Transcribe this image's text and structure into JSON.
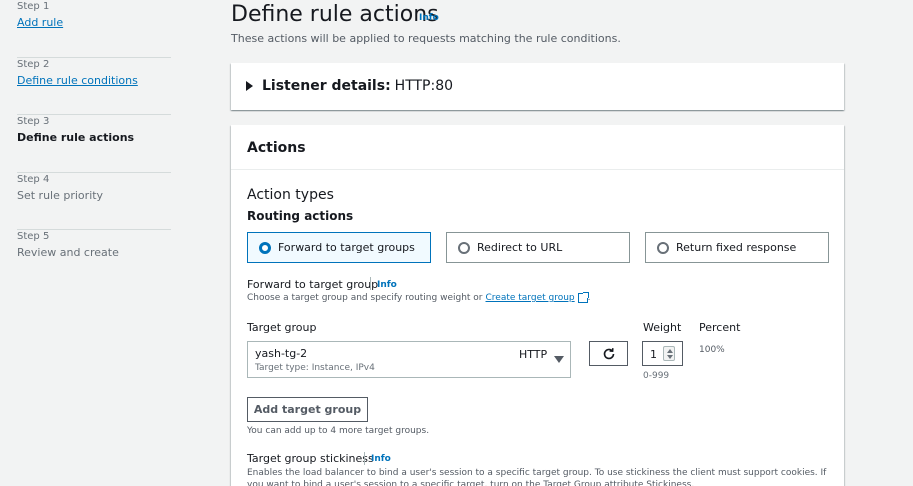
{
  "steps": [
    {
      "num": "Step 1",
      "title": "Add rule"
    },
    {
      "num": "Step 2",
      "title": "Define rule conditions"
    },
    {
      "num": "Step 3",
      "title": "Define rule actions"
    },
    {
      "num": "Step 4",
      "title": "Set rule priority"
    },
    {
      "num": "Step 5",
      "title": "Review and create"
    }
  ],
  "header": {
    "title": "Define rule actions",
    "info": "Info",
    "description": "These actions will be applied to requests matching the rule conditions."
  },
  "listener": {
    "label": "Listener details:",
    "value": "HTTP:80"
  },
  "actions": {
    "title": "Actions",
    "action_types": "Action types",
    "routing_actions": "Routing actions",
    "options": [
      {
        "label": "Forward to target groups",
        "selected": true
      },
      {
        "label": "Redirect to URL",
        "selected": false
      },
      {
        "label": "Return fixed response",
        "selected": false
      }
    ],
    "forward": {
      "label": "Forward to target group",
      "info": "Info",
      "description": "Choose a target group and specify routing weight or",
      "create_link": "Create target group",
      "period": "."
    },
    "target_group_col": "Target group",
    "weight_col": "Weight",
    "percent_col": "Percent",
    "target_group": {
      "name": "yash-tg-2",
      "subtitle": "Target type: Instance, IPv4",
      "protocol": "HTTP"
    },
    "weight": {
      "value": "1",
      "hint": "0-999"
    },
    "percent": "100%",
    "add_button": "Add target group",
    "add_hint": "You can add up to 4 more target groups.",
    "stickiness": {
      "label": "Target group stickiness",
      "info": "Info",
      "description": "Enables the load balancer to bind a user's session to a specific target group. To use stickiness the client must support cookies. If you want to bind a user's session to a specific target, turn on the Target Group attribute Stickiness."
    }
  },
  "colors": {
    "link": "#0073bb",
    "selected_bg": "#f1faff",
    "page_bg": "#f2f3f3"
  },
  "icons": [
    "caret-right-icon",
    "radio-icon",
    "external-link-icon",
    "refresh-icon",
    "dropdown-caret-icon",
    "spinner-icon"
  ]
}
